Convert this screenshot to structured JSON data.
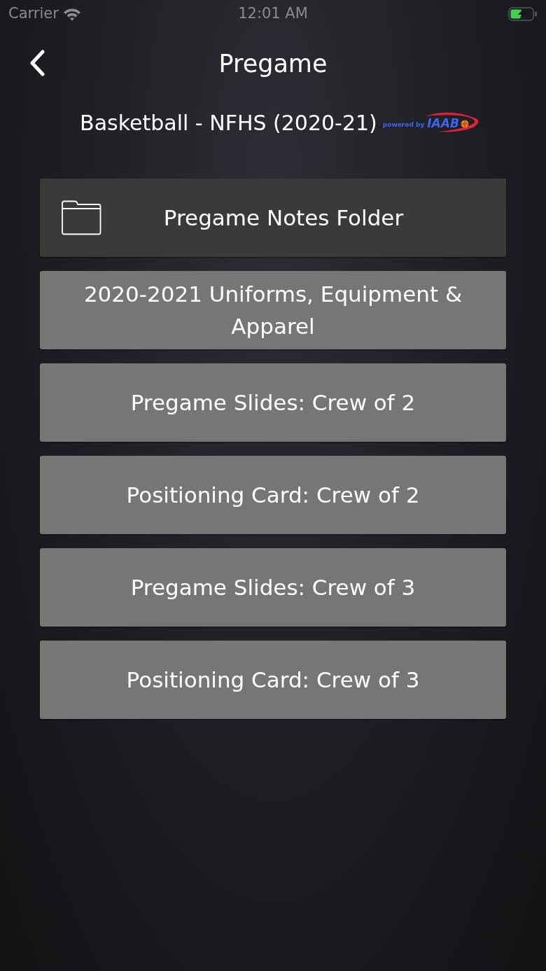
{
  "status_bar": {
    "carrier": "Carrier",
    "time": "12:01 AM",
    "battery": {
      "charging": true
    }
  },
  "header": {
    "title": "Pregame",
    "subtitle": "Basketball - NFHS (2020-21)",
    "logo": {
      "tagline": "powered by",
      "name": "IAAB"
    }
  },
  "items": [
    {
      "kind": "folder",
      "label": "Pregame Notes Folder"
    },
    {
      "kind": "item",
      "label": "2020-2021 Uniforms, Equipment & Apparel"
    },
    {
      "kind": "item",
      "label": "Pregame Slides: Crew of 2"
    },
    {
      "kind": "item",
      "label": "Positioning Card: Crew of 2"
    },
    {
      "kind": "item",
      "label": "Pregame Slides: Crew of 3"
    },
    {
      "kind": "item",
      "label": "Positioning Card: Crew of 3"
    }
  ]
}
